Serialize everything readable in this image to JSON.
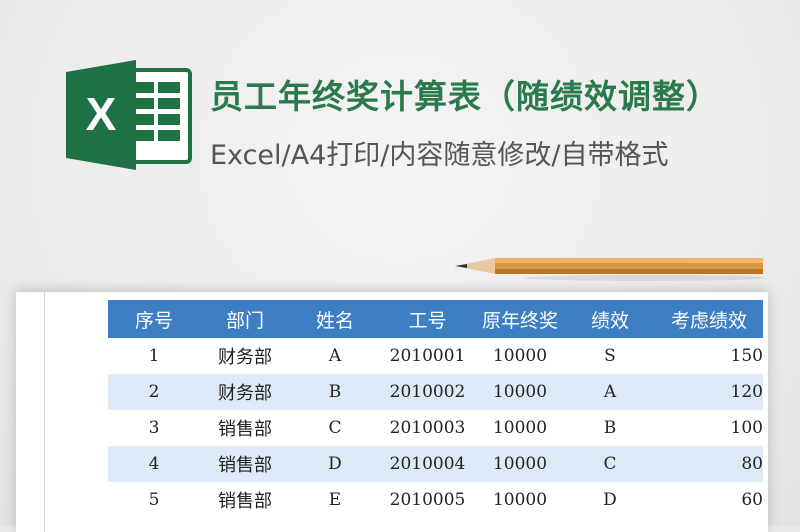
{
  "header": {
    "title": "员工年终奖计算表（随绩效调整）",
    "subtitle": "Excel/A4打印/内容随意修改/自带格式",
    "logo_letter": "X",
    "accent": "#2a7a4b"
  },
  "table": {
    "header_color": "#3e7fc4",
    "stripe_color": "#dde9f6",
    "columns": [
      "序号",
      "部门",
      "姓名",
      "工号",
      "原年终奖",
      "绩效",
      "考虑绩效"
    ],
    "rows": [
      [
        "1",
        "财务部",
        "A",
        "2010001",
        "10000",
        "S",
        "150"
      ],
      [
        "2",
        "财务部",
        "B",
        "2010002",
        "10000",
        "A",
        "120"
      ],
      [
        "3",
        "销售部",
        "C",
        "2010003",
        "10000",
        "B",
        "100"
      ],
      [
        "4",
        "销售部",
        "D",
        "2010004",
        "10000",
        "C",
        "80"
      ],
      [
        "5",
        "销售部",
        "E",
        "2010005",
        "10000",
        "D",
        "60"
      ]
    ]
  }
}
